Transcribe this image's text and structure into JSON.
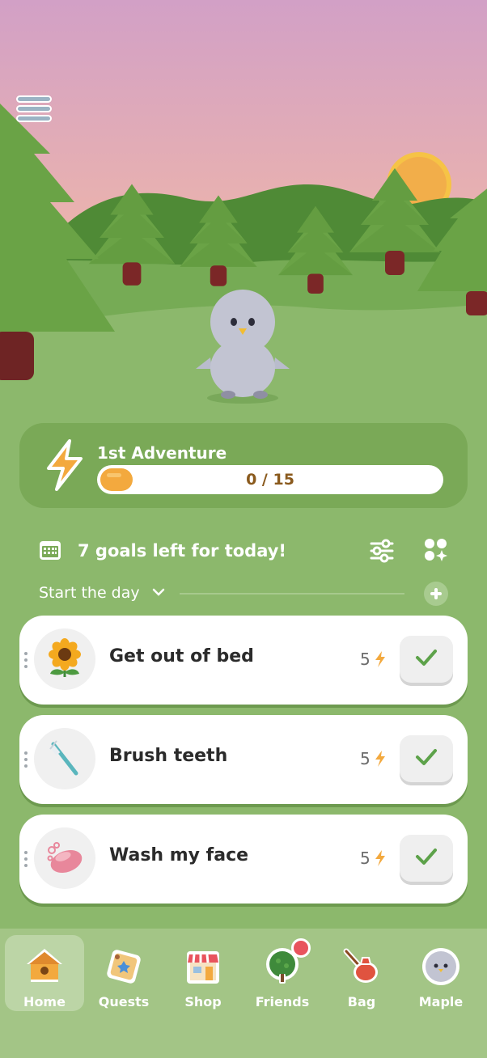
{
  "adventure": {
    "title": "1st Adventure",
    "progress_text": "0 / 15",
    "progress_current": 0,
    "progress_total": 15
  },
  "goals": {
    "header": "7 goals left for today!",
    "section": "Start the day"
  },
  "tasks": [
    {
      "label": "Get out of bed",
      "points": "5",
      "icon": "sunflower-icon"
    },
    {
      "label": "Brush teeth",
      "points": "5",
      "icon": "toothbrush-icon"
    },
    {
      "label": "Wash my face",
      "points": "5",
      "icon": "soap-icon"
    }
  ],
  "nav": {
    "items": [
      {
        "label": "Home",
        "icon": "home-birdhouse-icon",
        "active": true
      },
      {
        "label": "Quests",
        "icon": "quest-scroll-icon"
      },
      {
        "label": "Shop",
        "icon": "shop-store-icon"
      },
      {
        "label": "Friends",
        "icon": "friends-tree-icon",
        "badge": true
      },
      {
        "label": "Bag",
        "icon": "bag-bundle-icon"
      },
      {
        "label": "Maple",
        "icon": "maple-bird-icon"
      }
    ]
  },
  "colors": {
    "background": "#8cb86c",
    "panel": "#7aa957",
    "accent_orange": "#f3a93e",
    "check_green": "#5da24a",
    "badge_red": "#e8545d"
  }
}
